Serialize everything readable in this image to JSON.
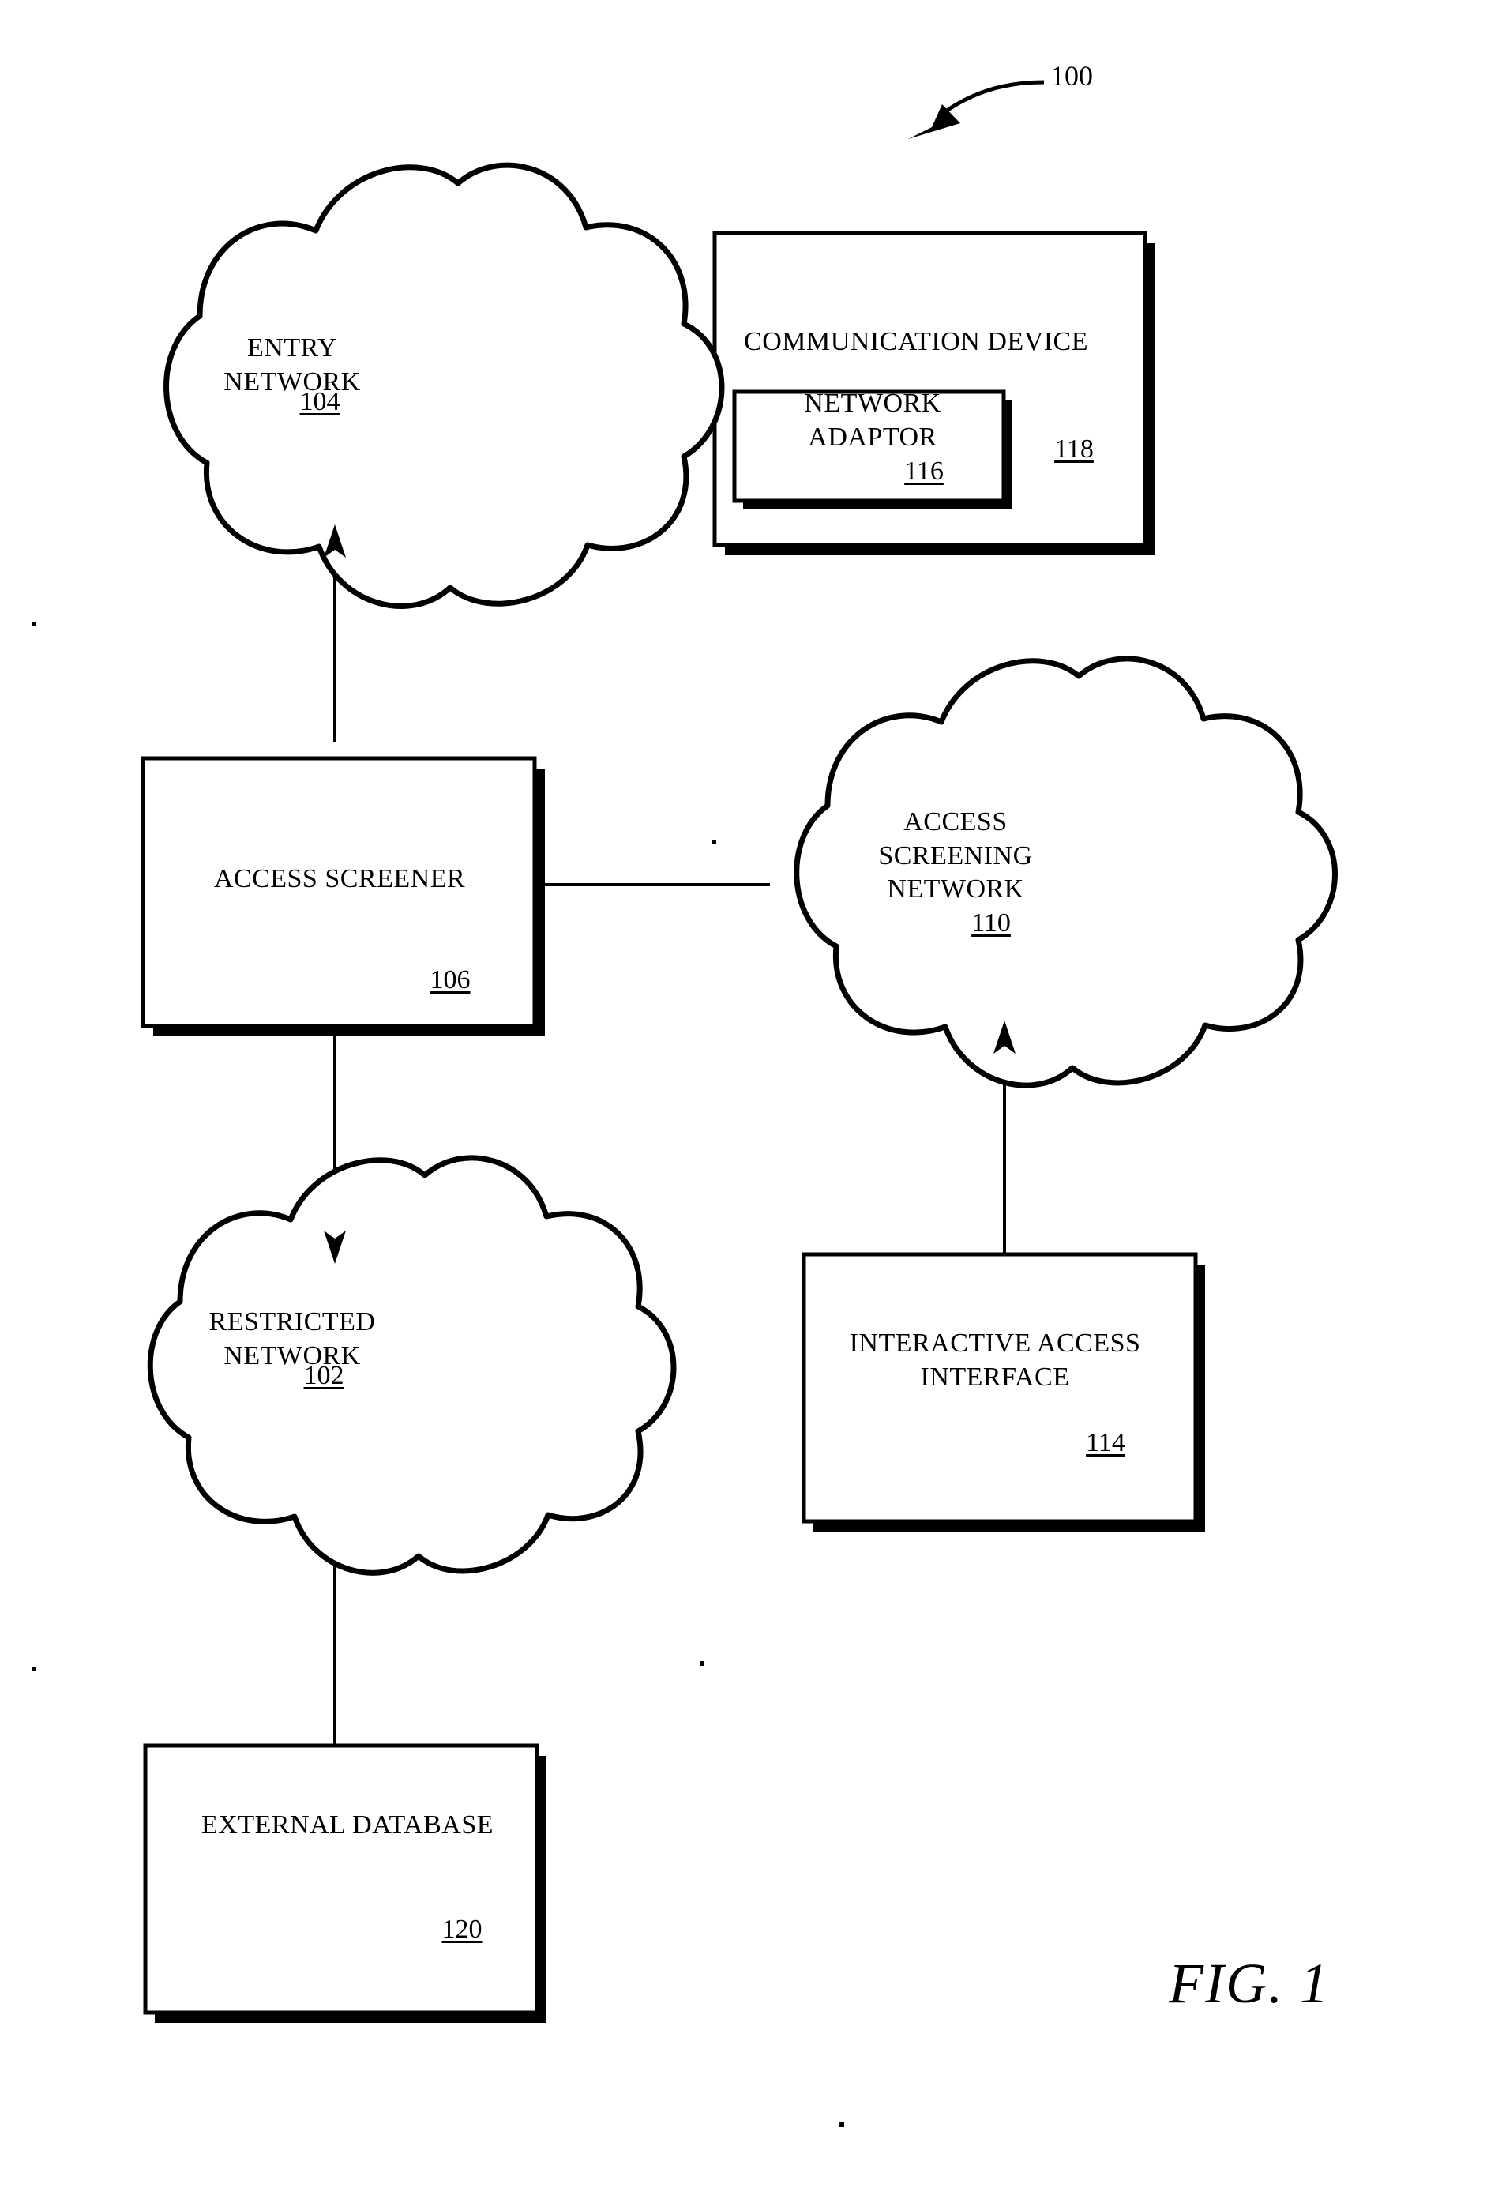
{
  "figure": {
    "caption": "FIG. 1",
    "system_ref": "100"
  },
  "nodes": {
    "entry_network": {
      "label": "ENTRY\nNETWORK",
      "ref": "104",
      "shape": "cloud"
    },
    "communication_device": {
      "label": "COMMUNICATION DEVICE",
      "ref": "118",
      "shape": "box"
    },
    "network_adaptor": {
      "label": "NETWORK\nADAPTOR",
      "ref": "116",
      "shape": "box"
    },
    "access_screener": {
      "label": "ACCESS SCREENER",
      "ref": "106",
      "shape": "box"
    },
    "access_screening_network": {
      "label": "ACCESS\nSCREENING\nNETWORK",
      "ref": "110",
      "shape": "cloud"
    },
    "restricted_network": {
      "label": "RESTRICTED\nNETWORK",
      "ref": "102",
      "shape": "cloud"
    },
    "interactive_access_interface": {
      "label": "INTERACTIVE ACCESS\nINTERFACE",
      "ref": "114",
      "shape": "box"
    },
    "external_database": {
      "label": "EXTERNAL DATABASE",
      "ref": "120",
      "shape": "box"
    }
  },
  "connections": [
    {
      "from": "entry_network",
      "to": "communication_device",
      "style": "plain"
    },
    {
      "from": "access_screener",
      "to": "entry_network",
      "style": "arrow-up"
    },
    {
      "from": "access_screener",
      "to": "access_screening_network",
      "style": "plain"
    },
    {
      "from": "access_screener",
      "to": "restricted_network",
      "style": "arrow-down"
    },
    {
      "from": "interactive_access_interface",
      "to": "access_screening_network",
      "style": "arrow-up"
    },
    {
      "from": "external_database",
      "to": "restricted_network",
      "style": "plain"
    }
  ],
  "colors": {
    "ink": "#000000",
    "paper": "#ffffff"
  }
}
